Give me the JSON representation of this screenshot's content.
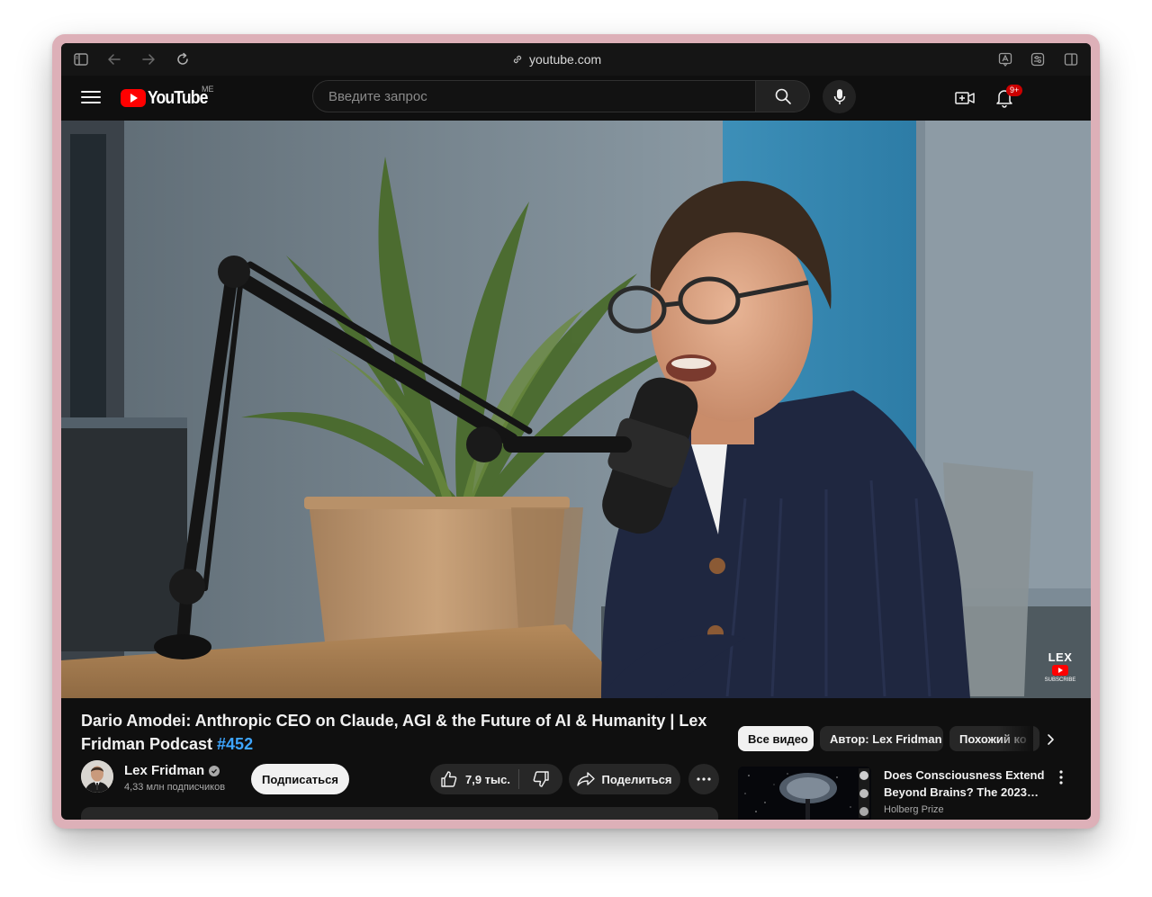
{
  "browser": {
    "url": "youtube.com"
  },
  "header": {
    "logo_text": "YouTube",
    "region": "ME",
    "search_placeholder": "Введите запрос",
    "notification_count": "9+"
  },
  "video": {
    "watermark_text": "LEX",
    "watermark_sub": "SUBSCRIBE"
  },
  "title": {
    "main": "Dario Amodei: Anthropic CEO on Claude, AGI & the Future of AI & Humanity | Lex Fridman Podcast ",
    "hashtag": "#452"
  },
  "channel": {
    "name": "Lex Fridman",
    "subscribers": "4,33 млн подписчиков",
    "subscribe_label": "Подписаться"
  },
  "actions": {
    "like_count": "7,9 тыс.",
    "share_label": "Поделиться"
  },
  "chips": [
    {
      "label": "Все видео",
      "active": true
    },
    {
      "label": "Автор: Lex Fridman",
      "active": false
    },
    {
      "label": "Похожий ко",
      "active": false
    }
  ],
  "recommendation": {
    "title": "Does Consciousness Extend Beyond Brains? The 2023…",
    "channel": "Holberg Prize"
  },
  "colors": {
    "background": "#0f0f0f",
    "accent_red": "#ff0000",
    "hashtag_blue": "#3ea6ff",
    "button_gray": "#272727"
  }
}
